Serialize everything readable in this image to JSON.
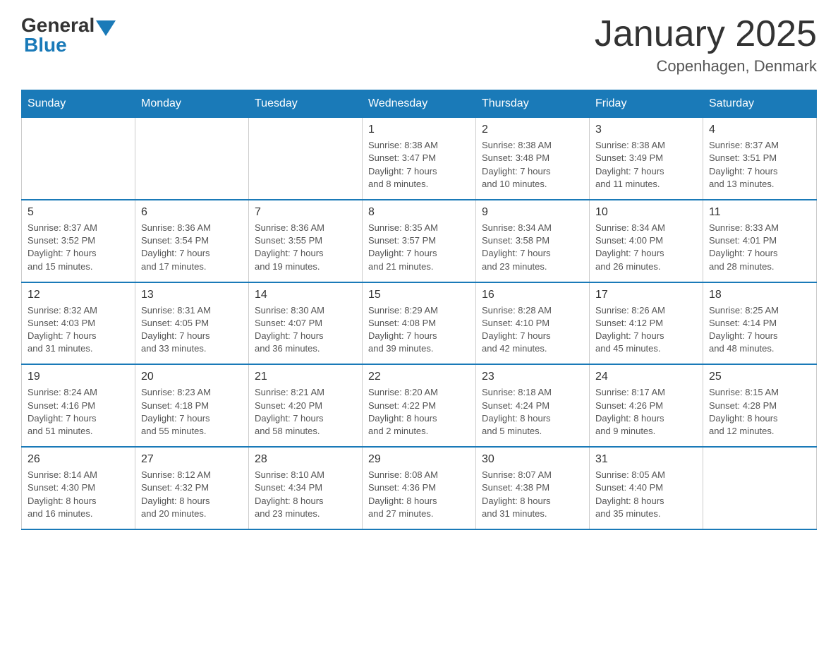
{
  "logo": {
    "general": "General",
    "blue": "Blue"
  },
  "title": "January 2025",
  "subtitle": "Copenhagen, Denmark",
  "days_of_week": [
    "Sunday",
    "Monday",
    "Tuesday",
    "Wednesday",
    "Thursday",
    "Friday",
    "Saturday"
  ],
  "weeks": [
    [
      {
        "day": "",
        "info": ""
      },
      {
        "day": "",
        "info": ""
      },
      {
        "day": "",
        "info": ""
      },
      {
        "day": "1",
        "info": "Sunrise: 8:38 AM\nSunset: 3:47 PM\nDaylight: 7 hours\nand 8 minutes."
      },
      {
        "day": "2",
        "info": "Sunrise: 8:38 AM\nSunset: 3:48 PM\nDaylight: 7 hours\nand 10 minutes."
      },
      {
        "day": "3",
        "info": "Sunrise: 8:38 AM\nSunset: 3:49 PM\nDaylight: 7 hours\nand 11 minutes."
      },
      {
        "day": "4",
        "info": "Sunrise: 8:37 AM\nSunset: 3:51 PM\nDaylight: 7 hours\nand 13 minutes."
      }
    ],
    [
      {
        "day": "5",
        "info": "Sunrise: 8:37 AM\nSunset: 3:52 PM\nDaylight: 7 hours\nand 15 minutes."
      },
      {
        "day": "6",
        "info": "Sunrise: 8:36 AM\nSunset: 3:54 PM\nDaylight: 7 hours\nand 17 minutes."
      },
      {
        "day": "7",
        "info": "Sunrise: 8:36 AM\nSunset: 3:55 PM\nDaylight: 7 hours\nand 19 minutes."
      },
      {
        "day": "8",
        "info": "Sunrise: 8:35 AM\nSunset: 3:57 PM\nDaylight: 7 hours\nand 21 minutes."
      },
      {
        "day": "9",
        "info": "Sunrise: 8:34 AM\nSunset: 3:58 PM\nDaylight: 7 hours\nand 23 minutes."
      },
      {
        "day": "10",
        "info": "Sunrise: 8:34 AM\nSunset: 4:00 PM\nDaylight: 7 hours\nand 26 minutes."
      },
      {
        "day": "11",
        "info": "Sunrise: 8:33 AM\nSunset: 4:01 PM\nDaylight: 7 hours\nand 28 minutes."
      }
    ],
    [
      {
        "day": "12",
        "info": "Sunrise: 8:32 AM\nSunset: 4:03 PM\nDaylight: 7 hours\nand 31 minutes."
      },
      {
        "day": "13",
        "info": "Sunrise: 8:31 AM\nSunset: 4:05 PM\nDaylight: 7 hours\nand 33 minutes."
      },
      {
        "day": "14",
        "info": "Sunrise: 8:30 AM\nSunset: 4:07 PM\nDaylight: 7 hours\nand 36 minutes."
      },
      {
        "day": "15",
        "info": "Sunrise: 8:29 AM\nSunset: 4:08 PM\nDaylight: 7 hours\nand 39 minutes."
      },
      {
        "day": "16",
        "info": "Sunrise: 8:28 AM\nSunset: 4:10 PM\nDaylight: 7 hours\nand 42 minutes."
      },
      {
        "day": "17",
        "info": "Sunrise: 8:26 AM\nSunset: 4:12 PM\nDaylight: 7 hours\nand 45 minutes."
      },
      {
        "day": "18",
        "info": "Sunrise: 8:25 AM\nSunset: 4:14 PM\nDaylight: 7 hours\nand 48 minutes."
      }
    ],
    [
      {
        "day": "19",
        "info": "Sunrise: 8:24 AM\nSunset: 4:16 PM\nDaylight: 7 hours\nand 51 minutes."
      },
      {
        "day": "20",
        "info": "Sunrise: 8:23 AM\nSunset: 4:18 PM\nDaylight: 7 hours\nand 55 minutes."
      },
      {
        "day": "21",
        "info": "Sunrise: 8:21 AM\nSunset: 4:20 PM\nDaylight: 7 hours\nand 58 minutes."
      },
      {
        "day": "22",
        "info": "Sunrise: 8:20 AM\nSunset: 4:22 PM\nDaylight: 8 hours\nand 2 minutes."
      },
      {
        "day": "23",
        "info": "Sunrise: 8:18 AM\nSunset: 4:24 PM\nDaylight: 8 hours\nand 5 minutes."
      },
      {
        "day": "24",
        "info": "Sunrise: 8:17 AM\nSunset: 4:26 PM\nDaylight: 8 hours\nand 9 minutes."
      },
      {
        "day": "25",
        "info": "Sunrise: 8:15 AM\nSunset: 4:28 PM\nDaylight: 8 hours\nand 12 minutes."
      }
    ],
    [
      {
        "day": "26",
        "info": "Sunrise: 8:14 AM\nSunset: 4:30 PM\nDaylight: 8 hours\nand 16 minutes."
      },
      {
        "day": "27",
        "info": "Sunrise: 8:12 AM\nSunset: 4:32 PM\nDaylight: 8 hours\nand 20 minutes."
      },
      {
        "day": "28",
        "info": "Sunrise: 8:10 AM\nSunset: 4:34 PM\nDaylight: 8 hours\nand 23 minutes."
      },
      {
        "day": "29",
        "info": "Sunrise: 8:08 AM\nSunset: 4:36 PM\nDaylight: 8 hours\nand 27 minutes."
      },
      {
        "day": "30",
        "info": "Sunrise: 8:07 AM\nSunset: 4:38 PM\nDaylight: 8 hours\nand 31 minutes."
      },
      {
        "day": "31",
        "info": "Sunrise: 8:05 AM\nSunset: 4:40 PM\nDaylight: 8 hours\nand 35 minutes."
      },
      {
        "day": "",
        "info": ""
      }
    ]
  ]
}
